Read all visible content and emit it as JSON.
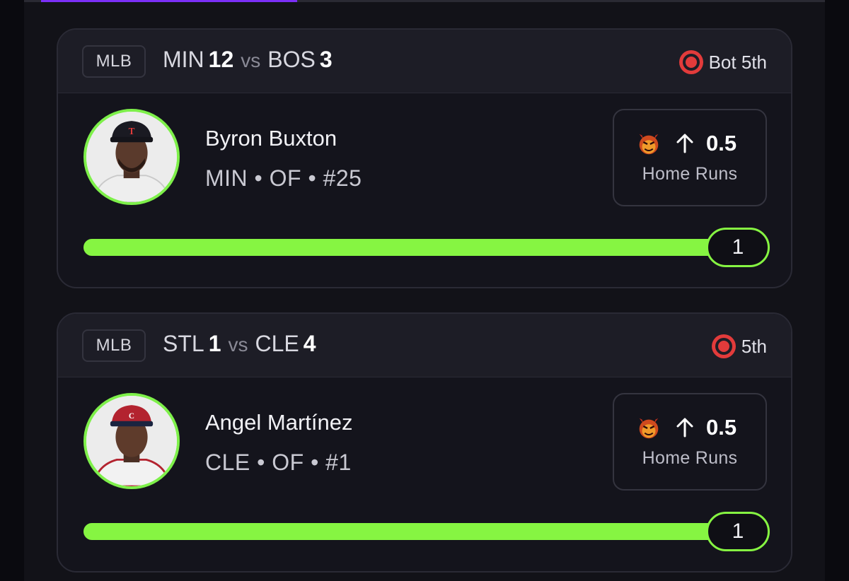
{
  "cards": [
    {
      "league": "MLB",
      "away_team": "MIN",
      "away_score": "12",
      "vs": "vs",
      "home_team": "BOS",
      "home_score": "3",
      "status": "Bot 5th",
      "player_name": "Byron Buxton",
      "player_meta": "MIN • OF • #25",
      "prop_line": "0.5",
      "prop_stat": "Home Runs",
      "progress_value": "1",
      "progress_fraction": 1.0,
      "cap_color": "#1a1a22",
      "jersey_color": "#eeeeee"
    },
    {
      "league": "MLB",
      "away_team": "STL",
      "away_score": "1",
      "vs": "vs",
      "home_team": "CLE",
      "home_score": "4",
      "status": "5th",
      "player_name": "Angel Martínez",
      "player_meta": "CLE • OF • #1",
      "prop_line": "0.5",
      "prop_stat": "Home Runs",
      "progress_value": "1",
      "progress_fraction": 1.0,
      "cap_color": "#b3232f",
      "jersey_color": "#f2f2f2"
    }
  ],
  "colors": {
    "accent_green": "#86f542",
    "live_red": "#e23b3b",
    "tab_purple": "#7b2ff7"
  },
  "icons": {
    "status": "live-indicator-icon",
    "prop": "devil-icon",
    "direction": "arrow-up-icon"
  }
}
